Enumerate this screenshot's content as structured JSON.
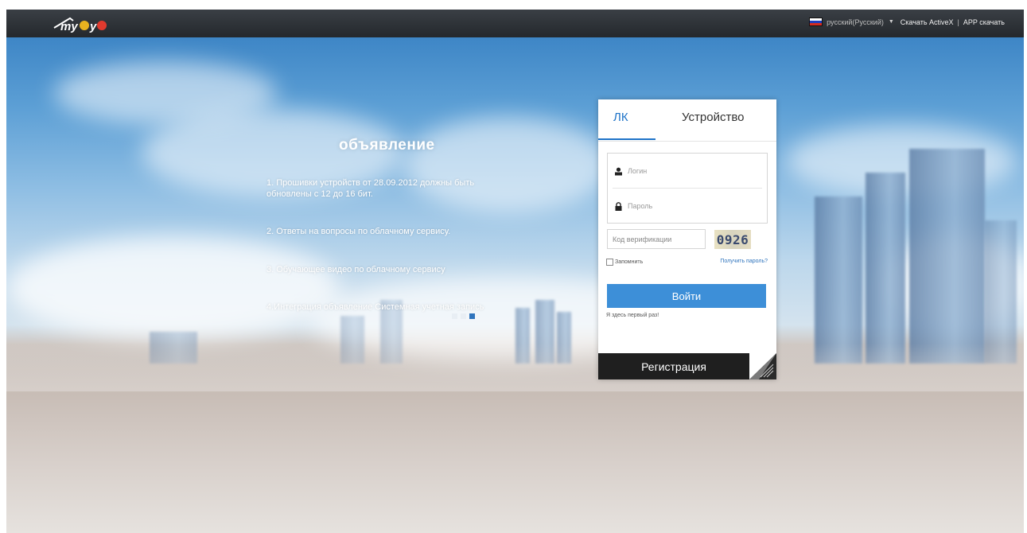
{
  "app": {
    "logo_text": "myeye"
  },
  "header": {
    "language": "русский(Русский)",
    "download_activex": "Скачать ActiveX",
    "separator": "|",
    "app_download": "APP скачать"
  },
  "announcement": {
    "title": "объявление",
    "items": [
      "1. Прошивки устройств от 28.09.2012 должны быть обновлены с 12 до 16 бит.",
      "2. Ответы на вопросы по облачному сервису.",
      "3. Обучающее видео по облачному сервису",
      "4.Интеграция объявление Системная учетная запись"
    ],
    "slider_total": 3,
    "slider_active": 3
  },
  "login": {
    "tabs": [
      "ЛК",
      "Устройство"
    ],
    "active_tab": "ЛК",
    "username_placeholder": "Логин",
    "password_placeholder": "Пароль",
    "captcha_placeholder": "Код верификации",
    "captcha_code": "0926",
    "remember_label": "Запомнить",
    "forgot_label": "Получить пароль?",
    "login_button": "Войти",
    "first_time_label": "Я здесь первый раз!",
    "register_button": "Регистрация"
  },
  "colors": {
    "accent": "#1e73c8",
    "button": "#3d8fd8",
    "register_bg": "#1f1f1f",
    "topbar": "#2b2f33"
  }
}
